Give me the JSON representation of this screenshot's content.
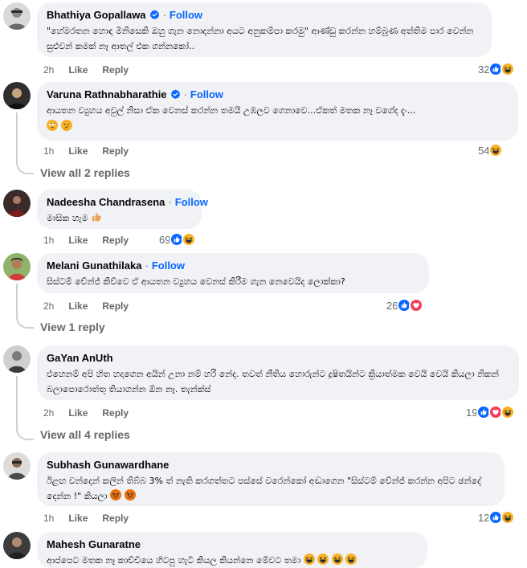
{
  "colors": {
    "like_blue": "#0866ff",
    "haha_yellow": "#f7b125",
    "love_red": "#f33e58",
    "angry_orange": "#e9710f",
    "bubble_bg": "#f0f2f5",
    "muted": "#65676b"
  },
  "action_labels": {
    "like": "Like",
    "reply": "Reply",
    "follow": "Follow",
    "dot": "·"
  },
  "comments": [
    {
      "author": "Bhathiya Gopallawa",
      "verified": true,
      "text": "\"හේමරතන හොඳ මිනිසෙකි ඔහු ගැන නොදන්නා අයට අනුකම්පා කරමු\" ආණ්ඩු කරන්න හම්බුණ අත්තිම පාර වෙන්න සුළුවන් කමක් නෑ ආතල් එක ගන්නකෝ..",
      "time": "2h",
      "reaction_count": "32",
      "reactions": [
        "like-icon",
        "haha-icon"
      ]
    },
    {
      "author": "Varuna Rathnabharathie",
      "verified": true,
      "text": "ආයතන ව්‍යුහය අවුල් නිසා ඒක වෙනස් කරන්න තමයි උඹලව ගෙනාවෙ...ඒකත් මතක නෑ වගේද දැං...",
      "time": "1h",
      "reaction_count": "54",
      "reactions": [
        "haha-icon"
      ],
      "view_replies": "View all 2 replies"
    },
    {
      "author": "Nadeesha Chandrasena",
      "verified": false,
      "text": "මාසික හැම",
      "time": "1h",
      "reaction_count": "69",
      "reactions": [
        "like-icon",
        "haha-icon"
      ]
    },
    {
      "author": "Melani Gunathilaka",
      "verified": false,
      "text": "සිස්ටම් චේන්ජ් කිව්වෙ ඒ ආයතන ව්‍යුහය වෙනස් කිරීම ගැන නෙවෙයිද ලොක්කා?",
      "time": "2h",
      "reaction_count": "26",
      "reactions": [
        "like-icon",
        "love-icon"
      ],
      "view_replies": "View 1 reply"
    },
    {
      "author": "GaYan AnUth",
      "verified": false,
      "text": "එහෙනම් අපි හිත හදාගෙන අයින් උනා නම් හරි නේද. තවත් නීතිය හොරුන්ට දූෂිතයින්ට ක්‍රියාත්මක වෙයි වෙයි කියලා නිකන් බලාපොරොත්තු තියාගන්න ඕන නෑ. තැන්ක්ස්",
      "time": "2h",
      "reaction_count": "19",
      "reactions": [
        "like-icon",
        "love-icon",
        "haha-icon"
      ],
      "view_replies": "View all 4 replies"
    },
    {
      "author": "Subhash Gunawardhane",
      "verified": false,
      "text": "ඊළඟ චන්දෙන් කලින් තිබ්බ 3% ත් නැති කරගත්තට පස්සේ වරෙන්කෝ අඬාගෙන \"සිස්ටම් චේන්ජ් කරන්න අපිට ඡන්දේ දෙන්න !\" කියලා",
      "time": "1h",
      "reaction_count": "12",
      "reactions": [
        "like-icon",
        "haha-icon"
      ]
    },
    {
      "author": "Mahesh Gunaratne",
      "verified": false,
      "text": "ආප්පෙට මතක නෑ කාච්චියෙ හිටපු හැටි කියල කියන්නෙ මේවට තමා"
    }
  ]
}
